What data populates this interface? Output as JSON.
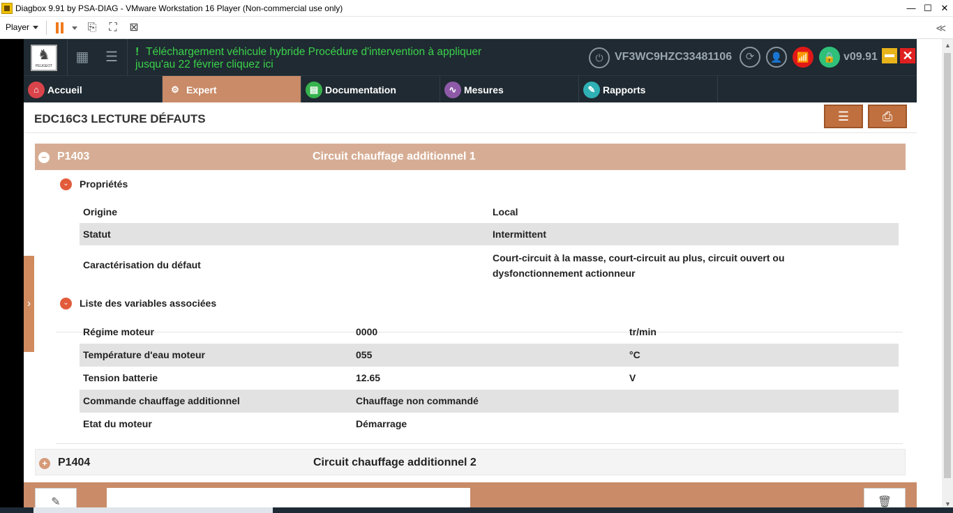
{
  "window": {
    "title": "Diagbox 9.91 by PSA-DIAG - VMware Workstation 16 Player (Non-commercial use only)",
    "min_glyph": "—",
    "max_glyph": "☐",
    "close_glyph": "✕"
  },
  "vmware_toolbar": {
    "player_label": "Player",
    "collapse_glyph": "≪",
    "icons": [
      "pause-icon",
      "send-ctrl-alt-del-icon",
      "fullscreen-icon",
      "unity-icon"
    ]
  },
  "header": {
    "logo_glyph": "♞",
    "logo_text": "PEUGEOT",
    "grid_glyph": "▦",
    "list_glyph": "☰",
    "alert_bang": "!",
    "alert_text": "Téléchargement véhicule hybride Procédure d'intervention à appliquer jusqu'au 22 février cliquez ici",
    "vin": "VF3WC9HZC33481106",
    "version": "v09.91",
    "power_glyph": "⏻",
    "refresh_glyph": "⟳",
    "user_glyph": "👤",
    "wifi_glyph": "📶",
    "lock_glyph": "🔒",
    "close_glyph": "✕"
  },
  "tabs": [
    {
      "label": "Accueil",
      "glyph": "⌂",
      "color": "#d9434a"
    },
    {
      "label": "Expert",
      "glyph": "⚙",
      "color": "#c98b68"
    },
    {
      "label": "Documentation",
      "glyph": "▤",
      "color": "#37b24d"
    },
    {
      "label": "Mesures",
      "glyph": "∿",
      "color": "#8e5aa8"
    },
    {
      "label": "Rapports",
      "glyph": "✎",
      "color": "#2fb0b5"
    }
  ],
  "page": {
    "title": "EDC16C3 LECTURE DÉFAUTS",
    "filter_glyph": "☰",
    "print_glyph": "⎙",
    "handle_glyph": "›"
  },
  "faults": [
    {
      "code": "P1403",
      "description": "Circuit chauffage additionnel 1",
      "toggle": "−"
    },
    {
      "code": "P1404",
      "description": "Circuit chauffage additionnel 2",
      "toggle": "+"
    }
  ],
  "properties": {
    "section_label": "Propriétés",
    "toggle_glyph": "⌄",
    "rows": [
      {
        "key": "Origine",
        "value": "Local"
      },
      {
        "key": "Statut",
        "value": "Intermittent"
      },
      {
        "key": "Caractérisation du défaut",
        "value": "Court-circuit à la masse, court-circuit au plus, circuit ouvert ou dysfonctionnement actionneur"
      }
    ]
  },
  "variables": {
    "section_label": "Liste des variables associées",
    "toggle_glyph": "⌄",
    "rows": [
      {
        "name": "Régime moteur",
        "value": "0000",
        "unit": "tr/min"
      },
      {
        "name": "Température d'eau moteur",
        "value": "055",
        "unit": "°C"
      },
      {
        "name": "Tension batterie",
        "value": "12.65",
        "unit": "V"
      },
      {
        "name": "Commande chauffage additionnel",
        "value": "Chauffage non commandé",
        "unit": ""
      },
      {
        "name": "Etat du moteur",
        "value": "Démarrage",
        "unit": ""
      }
    ]
  },
  "bottom": {
    "edit_glyph": "✎",
    "trash_glyph": "🗑",
    "comment_value": ""
  }
}
